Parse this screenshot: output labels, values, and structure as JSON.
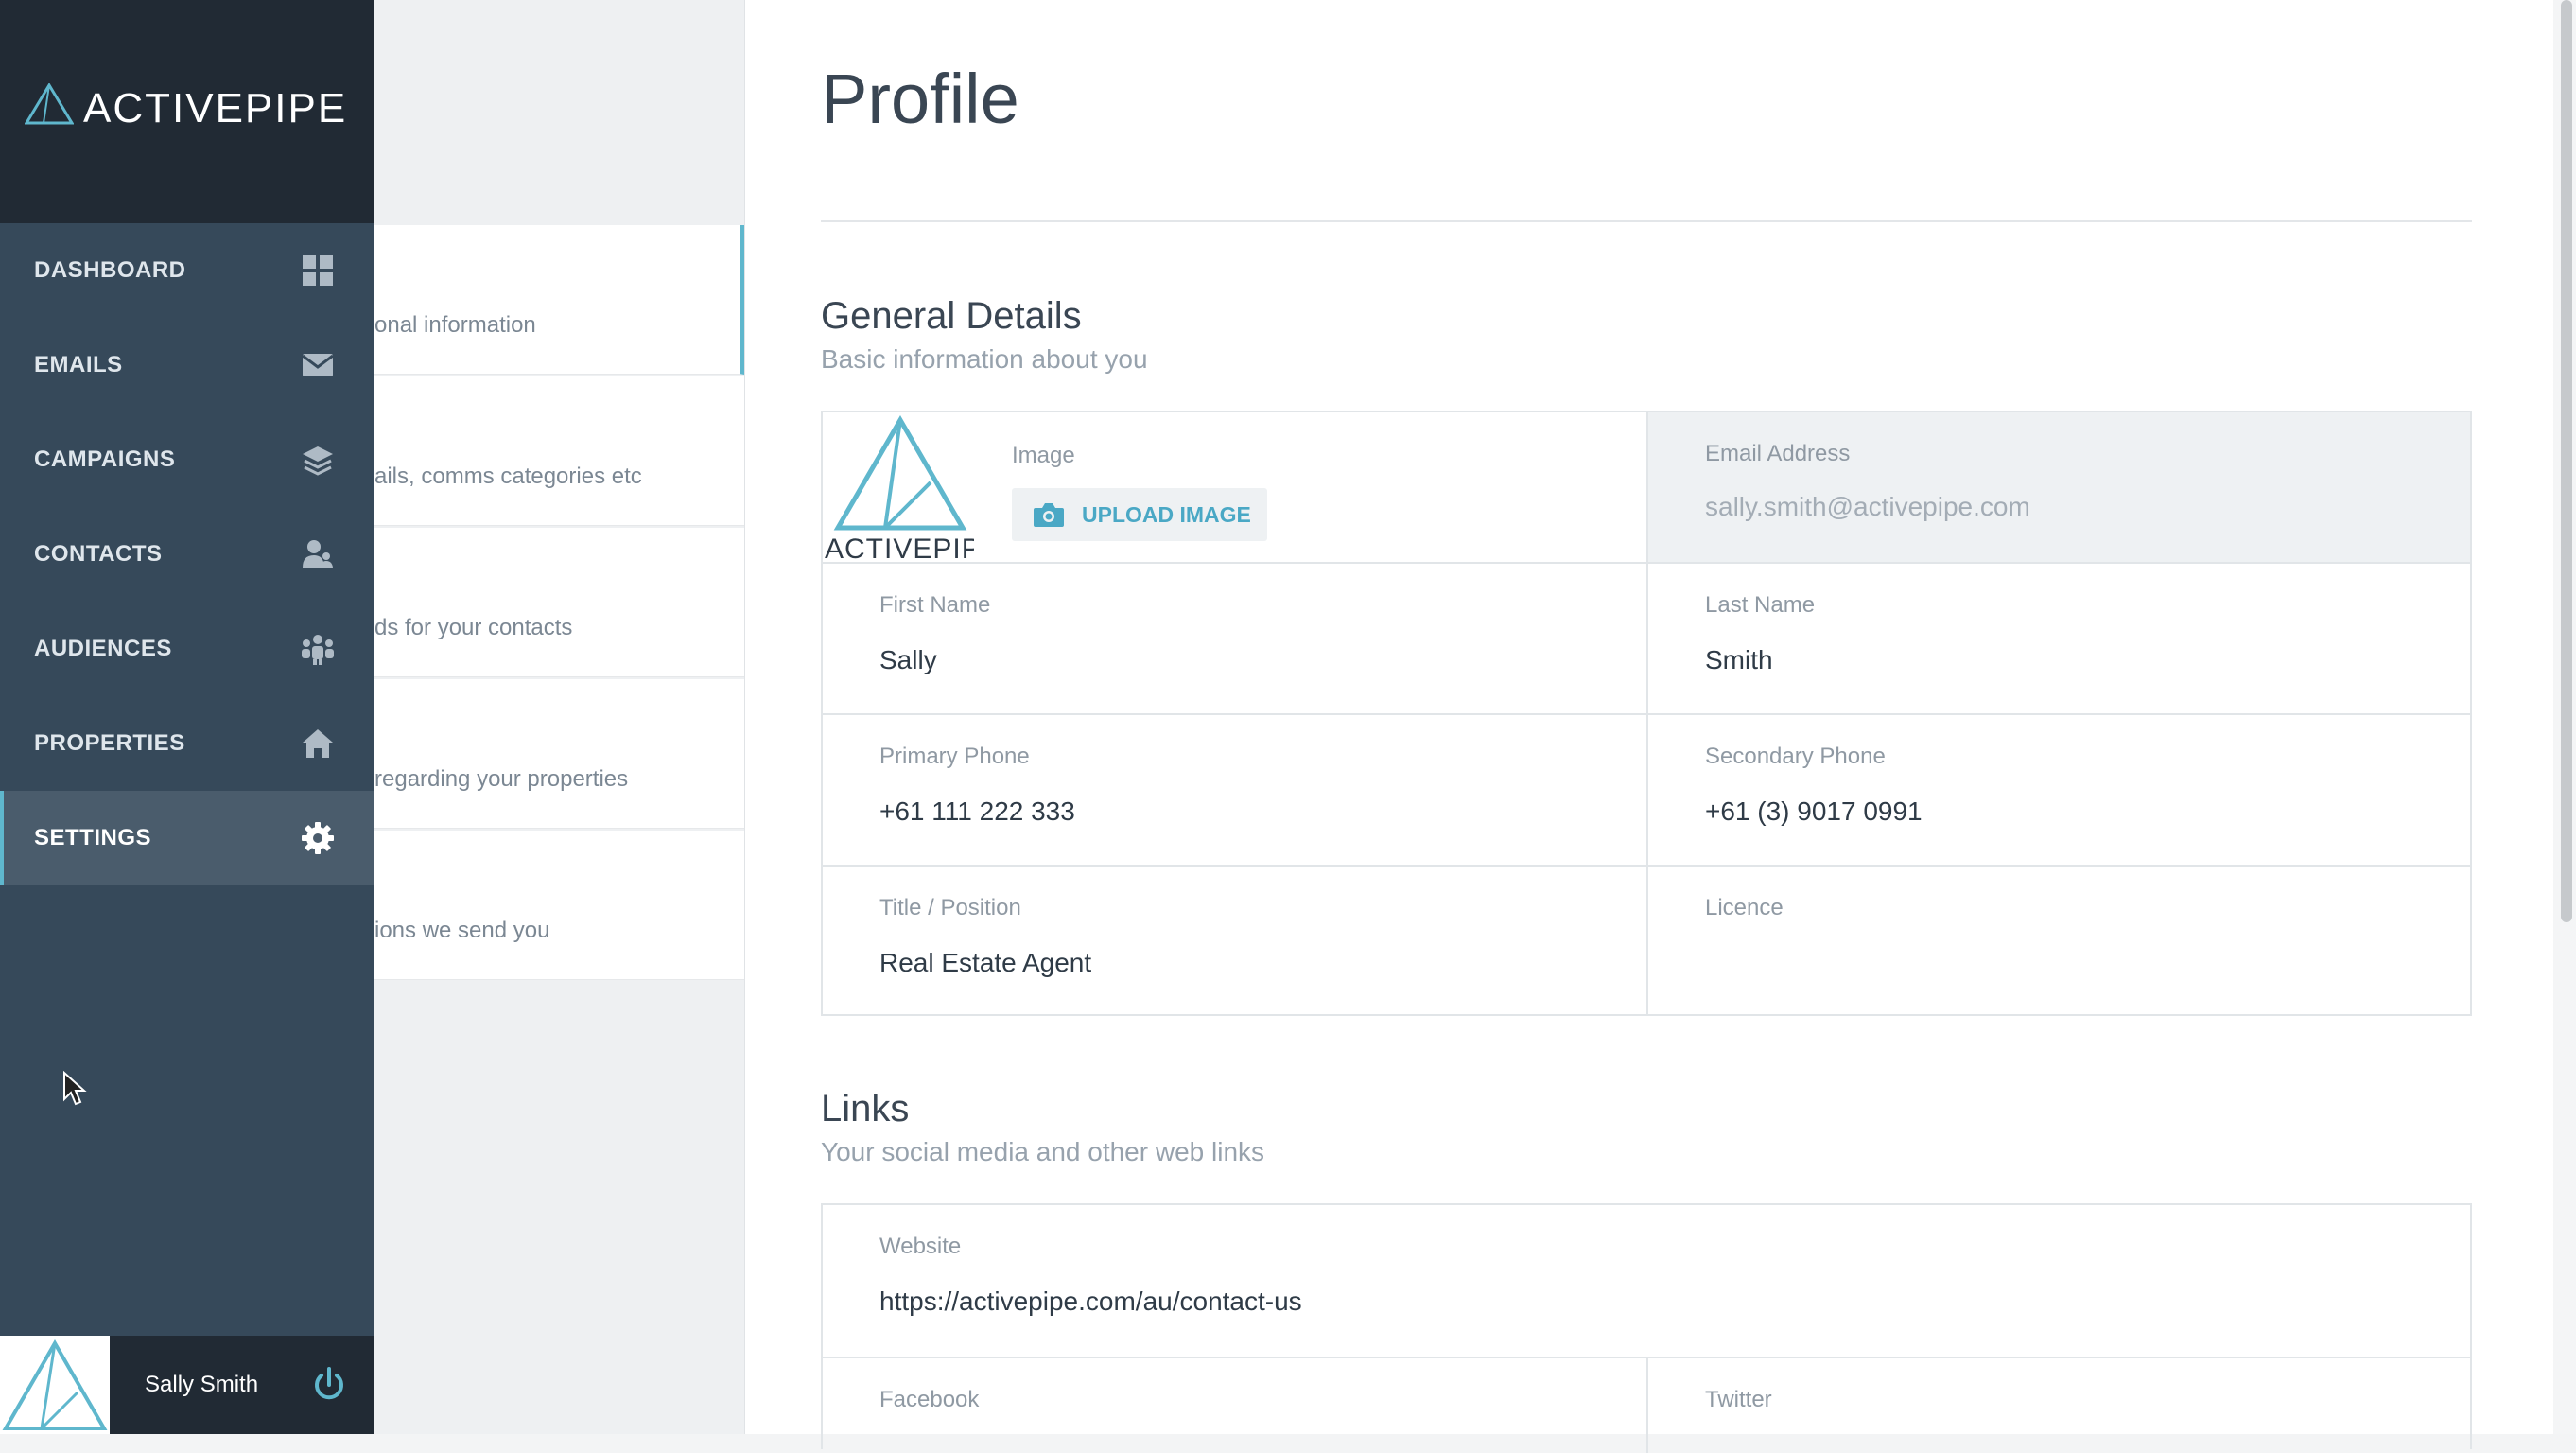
{
  "brand": {
    "name": "ACTIVEPIPE",
    "accent": "#5fb7cd"
  },
  "nav": {
    "items": [
      {
        "label": "DASHBOARD",
        "icon": "grid-icon"
      },
      {
        "label": "EMAILS",
        "icon": "envelope-icon"
      },
      {
        "label": "CAMPAIGNS",
        "icon": "layers-icon"
      },
      {
        "label": "CONTACTS",
        "icon": "contacts-icon"
      },
      {
        "label": "AUDIENCES",
        "icon": "audience-icon"
      },
      {
        "label": "PROPERTIES",
        "icon": "home-icon"
      },
      {
        "label": "SETTINGS",
        "icon": "gear-icon",
        "active": true
      }
    ]
  },
  "user": {
    "name": "Sally Smith"
  },
  "subnav": {
    "items": [
      {
        "desc": "onal information"
      },
      {
        "desc": "ails, comms categories etc"
      },
      {
        "desc": "ds for your contacts"
      },
      {
        "desc": "regarding your properties"
      },
      {
        "desc": "ions we send you"
      }
    ]
  },
  "page": {
    "title": "Profile"
  },
  "general": {
    "title": "General Details",
    "subtitle": "Basic information about you",
    "image_label": "Image",
    "upload_label": "UPLOAD IMAGE",
    "email_label": "Email Address",
    "email_value": "sally.smith@activepipe.com",
    "first_name_label": "First Name",
    "first_name_value": "Sally",
    "last_name_label": "Last Name",
    "last_name_value": "Smith",
    "primary_phone_label": "Primary Phone",
    "primary_phone_value": "+61 111 222 333",
    "secondary_phone_label": "Secondary Phone",
    "secondary_phone_value": "+61 (3) 9017 0991",
    "title_label": "Title / Position",
    "title_value": "Real Estate Agent",
    "licence_label": "Licence",
    "licence_value": ""
  },
  "links": {
    "title": "Links",
    "subtitle": "Your social media and other web links",
    "website_label": "Website",
    "website_value": "https://activepipe.com/au/contact-us",
    "facebook_label": "Facebook",
    "twitter_label": "Twitter"
  }
}
